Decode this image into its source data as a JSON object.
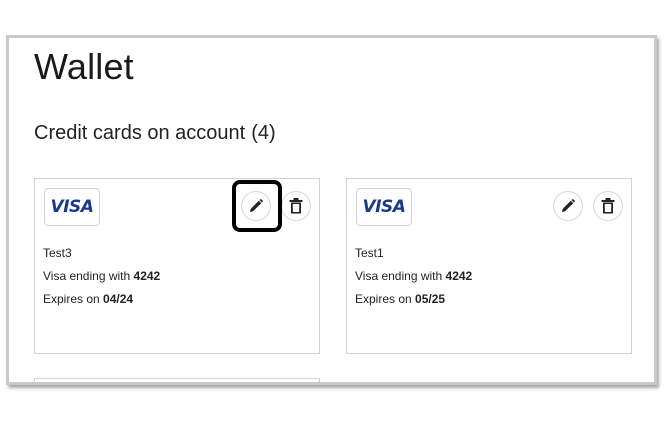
{
  "page": {
    "title": "Wallet",
    "section_title": "Credit cards on account",
    "section_count": "(4)"
  },
  "cards": [
    {
      "brand": "VISA",
      "name": "Test3",
      "ending_prefix": "Visa ending with",
      "last4": "4242",
      "expires_prefix": "Expires on",
      "expiry": "04/24",
      "edit_icon": "pencil-icon",
      "delete_icon": "trash-icon",
      "edit_highlighted": true
    },
    {
      "brand": "VISA",
      "name": "Test1",
      "ending_prefix": "Visa ending with",
      "last4": "4242",
      "expires_prefix": "Expires on",
      "expiry": "05/25",
      "edit_icon": "pencil-icon",
      "delete_icon": "trash-icon",
      "edit_highlighted": false
    }
  ],
  "colors": {
    "visa_brand": "#1a3a8a",
    "highlight_border": "#000000",
    "card_border": "#d2d2d2"
  }
}
